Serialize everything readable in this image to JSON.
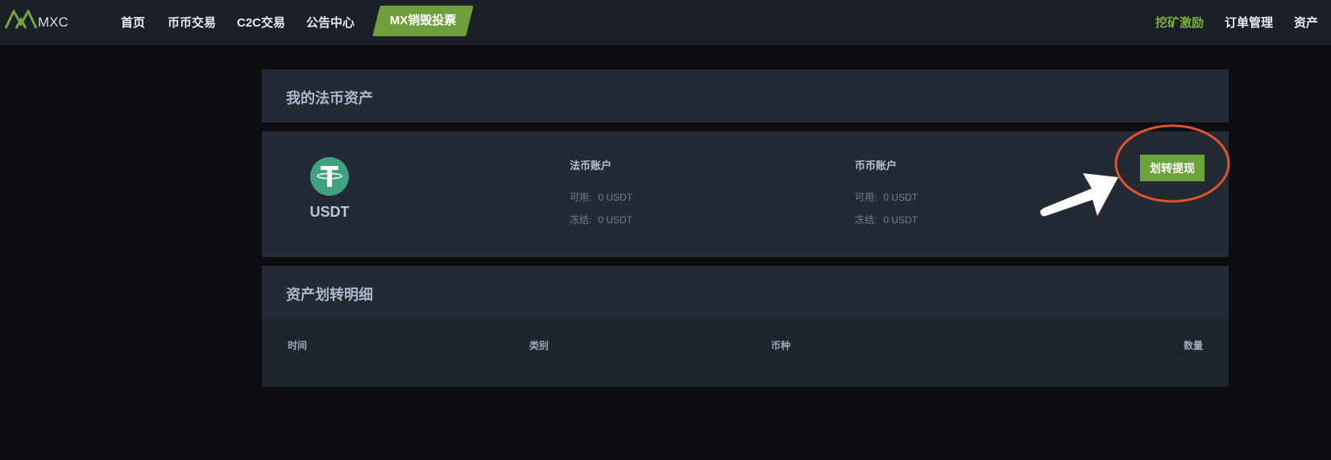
{
  "nav": {
    "logo_text": "MXC",
    "items": [
      {
        "label": "首页"
      },
      {
        "label": "币币交易"
      },
      {
        "label": "C2C交易"
      },
      {
        "label": "公告中心"
      }
    ],
    "vote_label": "MX销毁投票",
    "right_items": [
      {
        "label": "挖矿激励"
      },
      {
        "label": "订单管理"
      },
      {
        "label": "资产"
      }
    ],
    "accent_color": "#76b040"
  },
  "fiat_assets": {
    "title": "我的法币资产"
  },
  "asset_card": {
    "coin": "USDT",
    "coin_icon": "tether-icon",
    "fiat_account": {
      "title": "法币账户",
      "available_label": "可用:",
      "available_value": "0 USDT",
      "frozen_label": "冻结:",
      "frozen_value": "0 USDT"
    },
    "coin_account": {
      "title": "币币账户",
      "available_label": "可用:",
      "available_value": "0 USDT",
      "frozen_label": "冻结:",
      "frozen_value": "0 USDT"
    },
    "transfer_button": "划转提现",
    "button_color": "#6aa33a"
  },
  "transfer_details": {
    "title": "资产划转明细",
    "columns": [
      "时间",
      "类别",
      "币种",
      "数量"
    ]
  }
}
